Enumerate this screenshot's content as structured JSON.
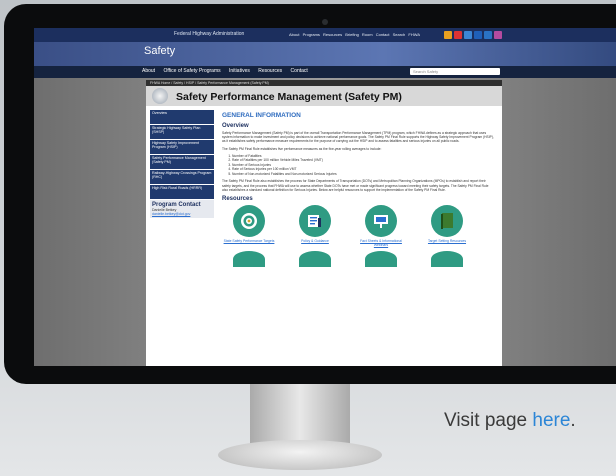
{
  "site": {
    "agency": "Federal Highway Administration",
    "top_nav": "About  Programs  Resources  Briefing Room  Contact  Search FHWA",
    "banner_title": "Safety",
    "main_nav": [
      "About",
      "Office of Safety Programs",
      "Initiatives",
      "Resources",
      "Contact"
    ],
    "search_placeholder": "Search Safety",
    "breadcrumb": "FHWA Home / Safety / HSIP / Safety Performance Management (Safety PM)",
    "page_title": "Safety Performance Management (Safety PM)"
  },
  "sidebar": {
    "items": [
      "Overview",
      "Strategic Highway Safety Plan (SHSP)",
      "Highway Safety Improvement Program (HSIP)",
      "Safety Performance Management (Safety PM)",
      "Railway-Highway Crossings Program (RHC)",
      "High Risk Rural Roads (HRRR)"
    ],
    "contact_title": "Program Contact",
    "contact_name": "Danielle Betkey",
    "contact_email": "danielle.betkey@dot.gov"
  },
  "content": {
    "general_heading": "GENERAL INFORMATION",
    "overview_heading": "Overview",
    "overview_text": "Safety Performance Management (Safety PM) is part of the overall Transportation Performance Management (TPM) program, which FHWA defines as a strategic approach that uses system information to make investment and policy decisions to achieve national performance goals. The Safety PM Final Rule supports the Highway Safety Improvement Program (HSIP), as it establishes safety performance measure requirements for the purpose of carrying out the HSIP and to assess fatalities and serious injuries on all public roads.",
    "measures_intro": "The Safety PM Final Rule establishes five performance measures as the five-year rolling averages to include:",
    "measures": [
      "Number of Fatalities",
      "Rate of Fatalities per 100 million Vehicle Miles Traveled (VMT)",
      "Number of Serious Injuries",
      "Rate of Serious Injuries per 100 million VMT",
      "Number of Non-motorized Fatalities and Non-motorized Serious Injuries"
    ],
    "rule_text": "The Safety PM Final Rule also establishes the process for State Departments of Transportation (DOTs) and Metropolitan Planning Organizations (MPOs) to establish and report their safety targets, and the process that FHWA will use to assess whether State DOTs have met or made significant progress toward meeting their safety targets. The Safety PM Final Rule also establishes a standard national definition for Serious Injuries. Below are helpful resources to support the implementation of the Safety PM Final Rule.",
    "resources_heading": "Resources",
    "resources": [
      {
        "label": "State Safety Performance Targets",
        "icon": "target-icon",
        "color": "#2f9b83"
      },
      {
        "label": "Policy & Guidance",
        "icon": "checklist-icon",
        "color": "#2f9b83"
      },
      {
        "label": "Fact Sheets & Informational Webinars",
        "icon": "presentation-icon",
        "color": "#2f9b83"
      },
      {
        "label": "Target Setting Resources",
        "icon": "book-icon",
        "color": "#2f9b83"
      }
    ]
  },
  "caption": {
    "text": "Visit page ",
    "link": "here",
    "end": "."
  },
  "colors": {
    "nav_blue": "#1c2f5e",
    "teal": "#2f9b83",
    "link": "#2b85d6"
  }
}
